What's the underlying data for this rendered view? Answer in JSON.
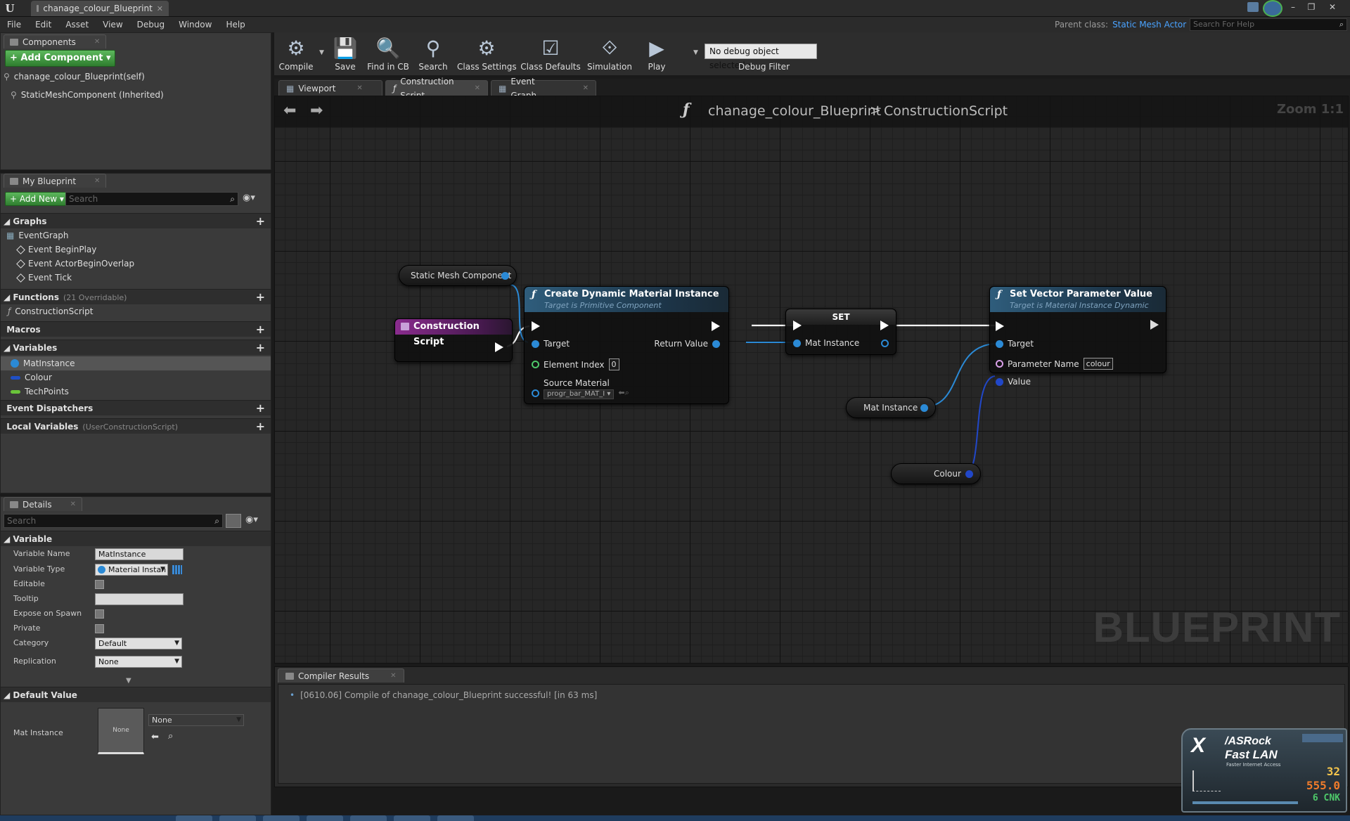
{
  "window": {
    "logo": "U",
    "doc_tab": "chanage_colour_Blueprint",
    "controls": [
      "–",
      "❐",
      "✕"
    ]
  },
  "menu": [
    "File",
    "Edit",
    "Asset",
    "View",
    "Debug",
    "Window",
    "Help"
  ],
  "parent_class": {
    "label": "Parent class:",
    "value": "Static Mesh Actor"
  },
  "help_search": {
    "placeholder": "Search For Help"
  },
  "components": {
    "tab": "Components",
    "add_button": "+ Add Component ▾",
    "items": [
      "chanage_colour_Blueprint(self)",
      "StaticMeshComponent (Inherited)"
    ]
  },
  "my_blueprint": {
    "tab": "My Blueprint",
    "add_new": "+ Add New ▾",
    "search_placeholder": "Search",
    "graphs_header": "Graphs",
    "event_graph": "EventGraph",
    "events": [
      "Event BeginPlay",
      "Event ActorBeginOverlap",
      "Event Tick"
    ],
    "functions_header": "Functions",
    "functions_count": "(21 Overridable)",
    "functions": [
      "ConstructionScript"
    ],
    "macros_header": "Macros",
    "variables_header": "Variables",
    "variables": [
      {
        "name": "MatInstance",
        "color": "#2b8ad6"
      },
      {
        "name": "Colour",
        "color": "#1f4fc4"
      },
      {
        "name": "TechPoints",
        "color": "#6ac43a"
      }
    ],
    "dispatchers_header": "Event Dispatchers",
    "local_vars_header": "Local Variables",
    "local_vars_scope": "(UserConstructionScript)"
  },
  "details": {
    "tab": "Details",
    "search_placeholder": "Search",
    "variable_section": "Variable",
    "rows": {
      "name_label": "Variable Name",
      "name_value": "MatInstance",
      "type_label": "Variable Type",
      "type_value": "Material Instan",
      "editable_label": "Editable",
      "tooltip_label": "Tooltip",
      "expose_label": "Expose on Spawn",
      "private_label": "Private",
      "category_label": "Category",
      "category_value": "Default",
      "replication_label": "Replication",
      "replication_value": "None"
    },
    "default_section": "Default Value",
    "default_label": "Mat Instance",
    "default_thumb": "None",
    "default_select": "None"
  },
  "toolbar": {
    "compile": "Compile",
    "save": "Save",
    "find_in_cb": "Find in CB",
    "search": "Search",
    "class_settings": "Class Settings",
    "class_defaults": "Class Defaults",
    "simulation": "Simulation",
    "play": "Play",
    "debug_filter_value": "No debug object selected ▾",
    "debug_filter_label": "Debug Filter"
  },
  "graph_tabs": [
    "Viewport",
    "Construction Script",
    "Event Graph"
  ],
  "breadcrumb": {
    "blueprint": "chanage_colour_Blueprint",
    "separator": ">",
    "graph": "ConstructionScript"
  },
  "zoom": "Zoom 1:1",
  "watermark": "BLUEPRINT",
  "nodes": {
    "static_mesh_getter": "Static Mesh Component",
    "construction_script": "Construction Script",
    "create_dmi": {
      "title": "Create Dynamic Material Instance",
      "subtitle": "Target is Primitive Component",
      "target": "Target",
      "element_index": "Element Index",
      "element_index_value": "0",
      "source_material": "Source Material",
      "source_material_value": "progr_bar_MAT_I ▾",
      "return_value": "Return Value"
    },
    "set": {
      "title": "SET",
      "pin": "Mat Instance"
    },
    "set_vector": {
      "title": "Set Vector Parameter Value",
      "subtitle": "Target is Material Instance Dynamic",
      "target": "Target",
      "parameter_name": "Parameter Name",
      "parameter_value": "colour",
      "value": "Value"
    },
    "mat_instance_getter": "Mat Instance",
    "colour_getter": "Colour"
  },
  "compiler": {
    "tab": "Compiler Results",
    "message": "[0610.06] Compile of chanage_colour_Blueprint successful! [in 63 ms]"
  },
  "asrock": {
    "brand_x": "X",
    "brand": "/ASRock",
    "product": "Fast LAN",
    "tagline": "Faster Internet Access",
    "n1": "32",
    "n2": "555.0",
    "n3": "6 CNK"
  }
}
